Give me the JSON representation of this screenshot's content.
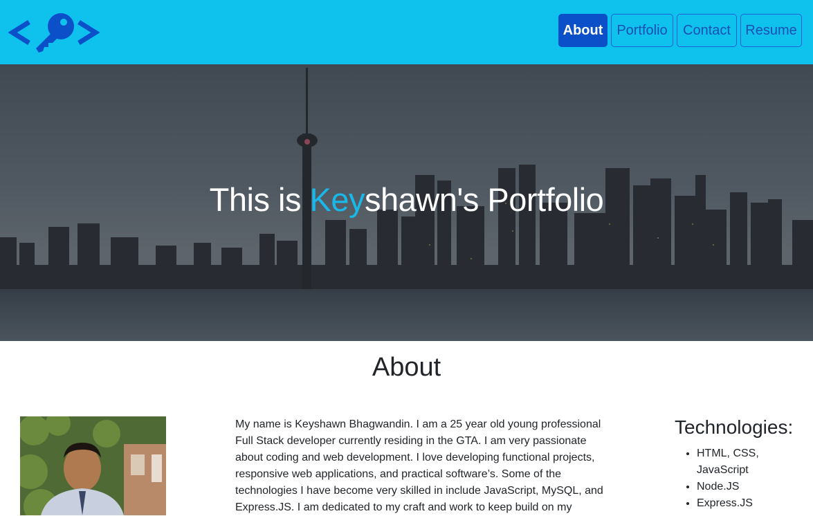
{
  "nav": {
    "items": [
      {
        "label": "About",
        "active": true
      },
      {
        "label": "Portfolio",
        "active": false
      },
      {
        "label": "Contact",
        "active": false
      },
      {
        "label": "Resume",
        "active": false
      }
    ]
  },
  "hero": {
    "title_prefix": "This is ",
    "title_accent": "Key",
    "title_suffix": "shawn's Portfolio"
  },
  "about": {
    "heading": "About",
    "bio": "My name is Keyshawn Bhagwandin. I am a 25 year old young professional Full Stack developer currently residing in the GTA. I am very passionate about coding and web development. I love developing functional projects, responsive web applications, and practical software’s. Some of the technologies I have become very skilled in include JavaScript, MySQL, and Express.JS. I am dedicated to my craft and work to keep build on my",
    "technologies_heading": "Technologies:",
    "technologies": [
      "HTML, CSS, JavaScript",
      "Node.JS",
      "Express.JS"
    ]
  },
  "colors": {
    "navbar_bg": "#0fc2ee",
    "active_button": "#0b4fc9",
    "logo": "#0b4fc9",
    "accent_text": "#1ab8e8"
  },
  "icons": {
    "logo": "key-code-logo-icon"
  }
}
